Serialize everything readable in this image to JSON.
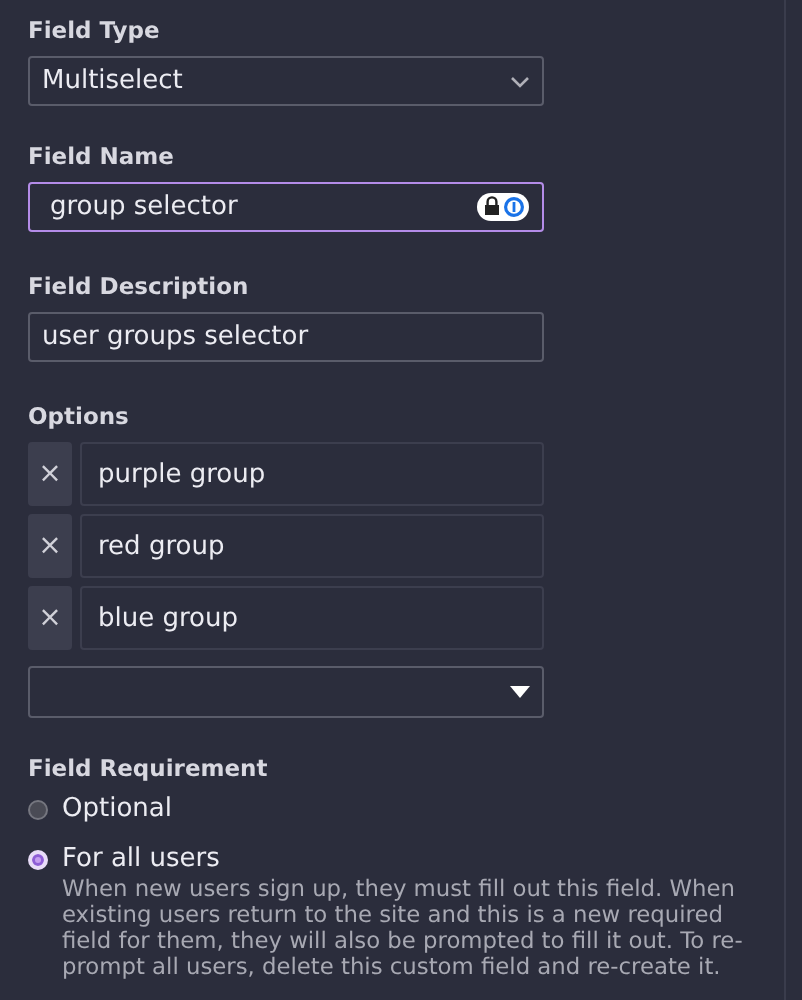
{
  "field_type": {
    "label": "Field Type",
    "value": "Multiselect"
  },
  "field_name": {
    "label": "Field Name",
    "value": "group selector",
    "focused": true
  },
  "field_description": {
    "label": "Field Description",
    "value": "user groups selector"
  },
  "options": {
    "label": "Options",
    "items": [
      {
        "value": "purple group"
      },
      {
        "value": "red group"
      },
      {
        "value": "blue group"
      }
    ],
    "remove_glyph": "×"
  },
  "requirement": {
    "label": "Field Requirement",
    "choices": [
      {
        "label": "Optional",
        "selected": false
      },
      {
        "label": "For all users",
        "selected": true,
        "description": "When new users sign up, they must fill out this field. When existing users return to the site and this is a new required field for them, they will also be prompted to fill it out. To re-prompt all users, delete this custom field and re-create it."
      }
    ]
  }
}
